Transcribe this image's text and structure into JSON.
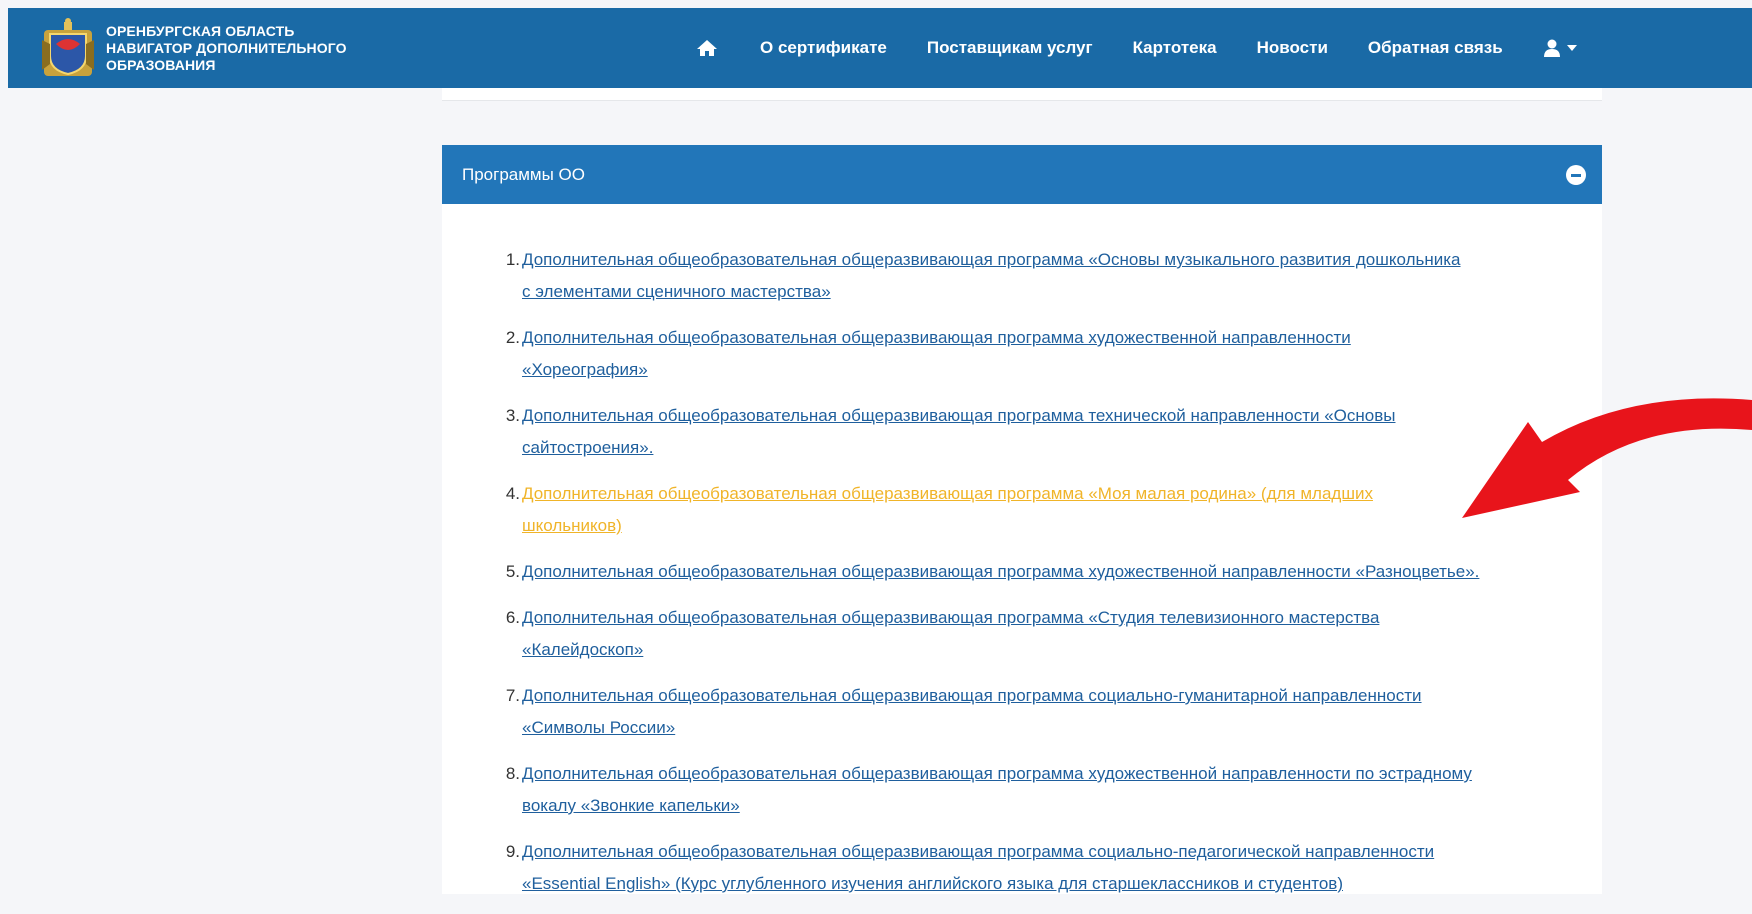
{
  "header": {
    "brand_line1": "ОРЕНБУРГСКАЯ ОБЛАСТЬ",
    "brand_line2": "НАВИГАТОР ДОПОЛНИТЕЛЬНОГО",
    "brand_line3": "ОБРАЗОВАНИЯ",
    "nav": [
      "О сертификате",
      "Поставщикам услуг",
      "Картотека",
      "Новости",
      "Обратная связь"
    ],
    "color": "#1a6aa6"
  },
  "panel": {
    "title": "Программы ОО",
    "color": "#2276b9"
  },
  "programs": [
    {
      "num": "1.",
      "line1": "Дополнительная общеобразовательная общеразвивающая программа «Основы музыкального развития дошкольника",
      "line2": "с элементами сценичного мастерства»"
    },
    {
      "num": "2.",
      "line1": "Дополнительная общеобразовательная общеразвивающая программа художественной направленности",
      "line2": "«Хореография»"
    },
    {
      "num": "3.",
      "line1": "Дополнительная общеобразовательная общеразвивающая программа технической направленности «Основы",
      "line2": "сайтостроения»."
    },
    {
      "num": "4.",
      "line1": "Дополнительная общеобразовательная общеразвивающая программа «Моя малая родина» (для младших",
      "line2": "школьников)"
    },
    {
      "num": "5.",
      "line1": "Дополнительная общеобразовательная общеразвивающая программа художественной направленности «Разноцветье».",
      "line2": ""
    },
    {
      "num": "6.",
      "line1": "Дополнительная общеобразовательная общеразвивающая программа «Студия телевизионного мастерства",
      "line2": "«Калейдоскоп»"
    },
    {
      "num": "7.",
      "line1": "Дополнительная общеобразовательная общеразвивающая программа социально-гуманитарной направленности",
      "line2": "«Символы России»"
    },
    {
      "num": "8.",
      "line1": "Дополнительная общеобразовательная общеразвивающая программа художественной направленности по эстрадному",
      "line2": "вокалу «Звонкие капельки»"
    },
    {
      "num": "9.",
      "line1": "Дополнительная общеобразовательная общеразвивающая программа социально-педагогической направленности",
      "line2": "«Essential English» (Курс углубленного изучения английского языка для старшеклассников и студентов)"
    }
  ],
  "colors": {
    "link": "#1f5f9d",
    "link_active": "#f0b429",
    "arrow": "#e8141b"
  },
  "icons": [
    "home-icon",
    "user-icon",
    "caret-down-icon",
    "minus-circle-icon",
    "coat-of-arms-emblem",
    "red-arrow-annotation"
  ]
}
